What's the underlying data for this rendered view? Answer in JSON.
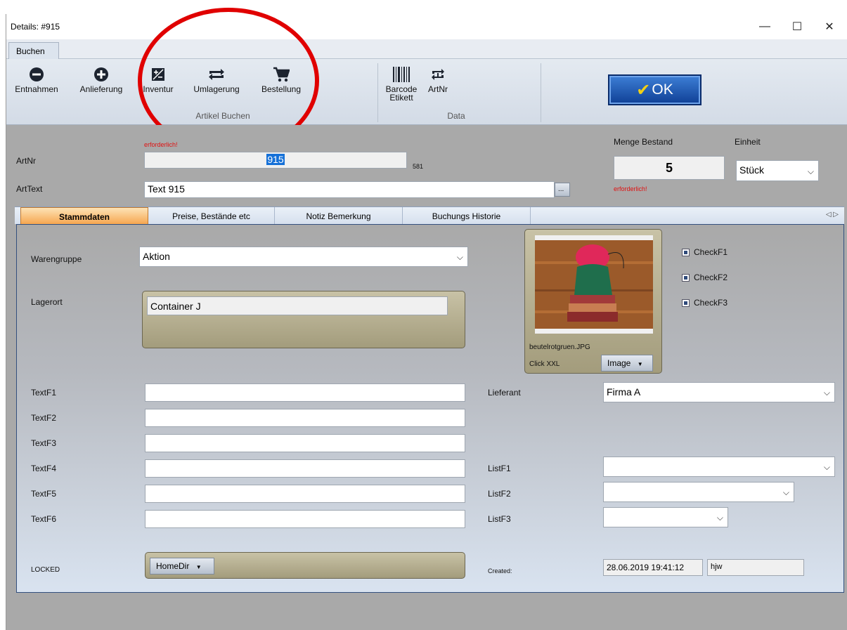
{
  "window": {
    "title": "Details: #915",
    "minimize": "—",
    "maximize": "☐",
    "close": "✕"
  },
  "ribbon": {
    "tab": "Buchen",
    "buttons": {
      "entnahmen": "Entnahmen",
      "anlieferung": "Anlieferung",
      "inventur": "Inventur",
      "umlagerung": "Umlagerung",
      "bestellung": "Bestellung",
      "barcode_1": "Barcode",
      "barcode_2": "Etikett",
      "artnr": "ArtNr"
    },
    "groups": {
      "artikel_buchen": "Artikel Buchen",
      "data": "Data"
    },
    "ok": "OK"
  },
  "header": {
    "artnr_label": "ArtNr",
    "artnr_required": "erforderlich!",
    "artnr_value": "915",
    "artnr_count": "581",
    "arttext_label": "ArtText",
    "arttext_value": "Text 915",
    "browse": "...",
    "menge_label": "Menge Bestand",
    "menge_value": "5",
    "menge_required": "erforderlich!",
    "einheit_label": "Einheit",
    "einheit_value": "Stück"
  },
  "tabs": [
    "Stammdaten",
    "Preise, Bestände etc",
    "Notiz Bemerkung",
    "Buchungs Historie"
  ],
  "tab_nav": "◁ ▷",
  "form": {
    "warengruppe_label": "Warengruppe",
    "warengruppe_value": "Aktion",
    "lagerort_label": "Lagerort",
    "lagerort_value": "Container J",
    "image_filename": "beutelrotgruen.JPG",
    "click_xxl": "Click XXL",
    "image_button": "Image",
    "checks": [
      "CheckF1",
      "CheckF2",
      "CheckF3"
    ],
    "text_labels": [
      "TextF1",
      "TextF2",
      "TextF3",
      "TextF4",
      "TextF5",
      "TextF6"
    ],
    "lieferant_label": "Lieferant",
    "lieferant_value": "Firma A",
    "list_labels": [
      "ListF1",
      "ListF2",
      "ListF3"
    ],
    "locked_label": "LOCKED",
    "homedir_button": "HomeDir",
    "created_label": "Created:",
    "created_value": "28.06.2019 19:41:12",
    "created_user": "hjw"
  },
  "colors": {
    "ok_button": "#1a4fa8",
    "required_text": "#e01010",
    "active_tab": "#f6a650",
    "annotation_circle": "#e00000"
  }
}
